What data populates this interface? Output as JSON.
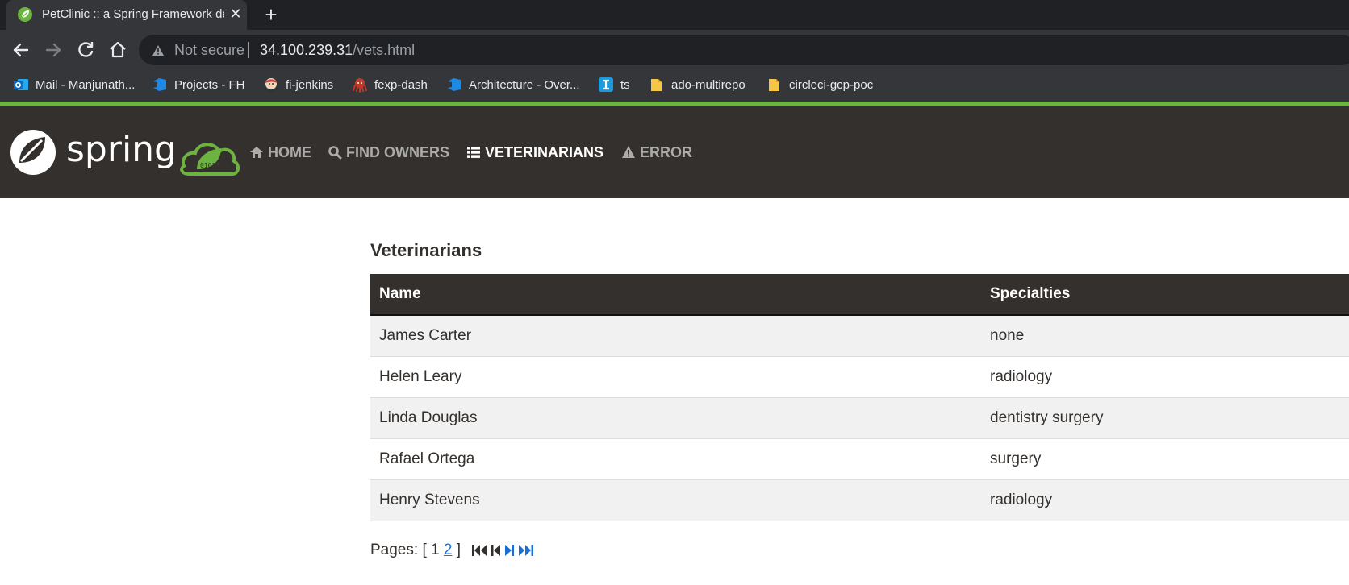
{
  "browser": {
    "tab_title": "PetClinic :: a Spring Framework demonstration",
    "security_label": "Not secure",
    "url_host": "34.100.239.31",
    "url_path": "/vets.html",
    "bookmarks": [
      {
        "label": "Mail - Manjunath...",
        "icon": "outlook-icon",
        "color": "#0f6cbd"
      },
      {
        "label": "Projects - FH",
        "icon": "azure-devops-icon",
        "color": "#1e88e5"
      },
      {
        "label": "fi-jenkins",
        "icon": "jenkins-icon",
        "color": "#d33833"
      },
      {
        "label": "fexp-dash",
        "icon": "octopus-icon",
        "color": "#c0392b"
      },
      {
        "label": "Architecture - Over...",
        "icon": "azure-devops-icon",
        "color": "#1e88e5"
      },
      {
        "label": "ts",
        "icon": "text-i-icon",
        "color": "#1a9be0"
      },
      {
        "label": "ado-multirepo",
        "icon": "folder-icon",
        "color": "#f6c744"
      },
      {
        "label": "circleci-gcp-poc",
        "icon": "folder-icon",
        "color": "#f6c744"
      }
    ]
  },
  "app": {
    "brand": "spring",
    "accent_color": "#6db33f",
    "header_bg": "#34302d",
    "nav": [
      {
        "label": "HOME",
        "icon": "home-icon",
        "active": false
      },
      {
        "label": "FIND OWNERS",
        "icon": "search-icon",
        "active": false
      },
      {
        "label": "VETERINARIANS",
        "icon": "list-icon",
        "active": true
      },
      {
        "label": "ERROR",
        "icon": "warning-icon",
        "active": false
      }
    ]
  },
  "main": {
    "title": "Veterinarians",
    "table": {
      "headers": [
        "Name",
        "Specialties"
      ],
      "rows": [
        {
          "name": "James Carter",
          "specialties": "none"
        },
        {
          "name": "Helen Leary",
          "specialties": "radiology"
        },
        {
          "name": "Linda Douglas",
          "specialties": "dentistry surgery"
        },
        {
          "name": "Rafael Ortega",
          "specialties": "surgery"
        },
        {
          "name": "Henry Stevens",
          "specialties": "radiology"
        }
      ]
    },
    "pagination": {
      "label": "Pages:",
      "open": "[",
      "close": "]",
      "current_page": "1",
      "other_page": "2",
      "controls": [
        "first-page-icon",
        "previous-page-icon",
        "next-page-icon",
        "last-page-icon"
      ]
    }
  }
}
